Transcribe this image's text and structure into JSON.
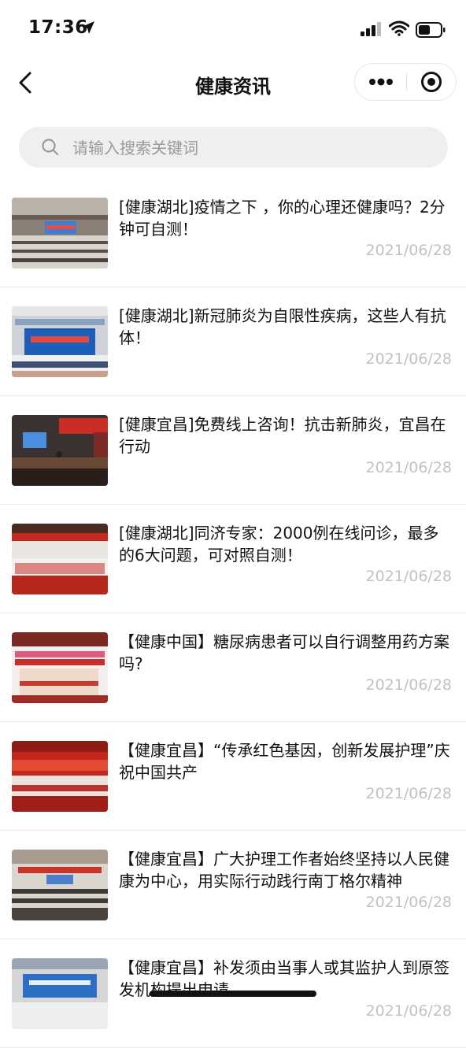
{
  "status": {
    "time": "17:36"
  },
  "nav": {
    "title": "健康资讯"
  },
  "search": {
    "placeholder": "请输入搜索关键词",
    "value": ""
  },
  "articles": [
    {
      "title": "[健康湖北]疫情之下 ，你的心理还健康吗？2分钟可自测！",
      "date": "2021/06/28"
    },
    {
      "title": "[健康湖北]新冠肺炎为自限性疾病，这些人有抗体！",
      "date": "2021/06/28"
    },
    {
      "title": "[健康宜昌]免费线上咨询！抗击新肺炎，宜昌在行动",
      "date": "2021/06/28"
    },
    {
      "title": "[健康湖北]同济专家：2000例在线问诊，最多的6大问题，可对照自测！",
      "date": "2021/06/28"
    },
    {
      "title": "【健康中国】糖尿病患者可以自行调整用药方案吗?",
      "date": "2021/06/28"
    },
    {
      "title": "【健康宜昌】“传承红色基因，创新发展护理”庆祝中国共产",
      "date": "2021/06/28"
    },
    {
      "title": "【健康宜昌】广大护理工作者始终坚持以人民健康为中心，用实际行动践行南丁格尔精神",
      "date": "2021/06/28"
    },
    {
      "title": "【健康宜昌】补发须由当事人或其监护人到原签发机构提出申请",
      "date": "2021/06/28"
    }
  ]
}
